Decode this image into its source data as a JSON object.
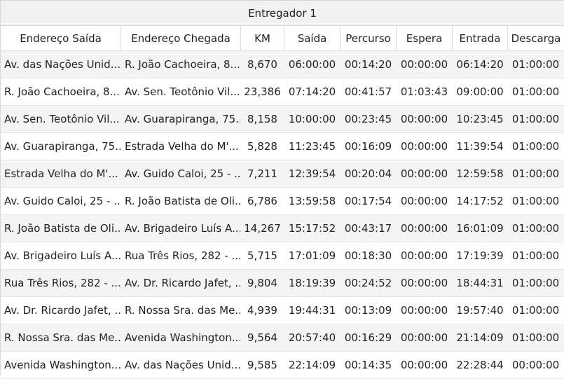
{
  "table": {
    "title": "Entregador 1",
    "columns": [
      "Endereço Saída",
      "Endereço Chegada",
      "KM",
      "Saída",
      "Percurso",
      "Espera",
      "Entrada",
      "Descarga"
    ],
    "rows": [
      [
        "Av. das Nações Unid...",
        "R. João Cachoeira, 8...",
        "8,670",
        "06:00:00",
        "00:14:20",
        "00:00:00",
        "06:14:20",
        "01:00:00"
      ],
      [
        "R. João Cachoeira, 8...",
        "Av. Sen. Teotônio Vil...",
        "23,386",
        "07:14:20",
        "00:41:57",
        "01:03:43",
        "09:00:00",
        "01:00:00"
      ],
      [
        "Av. Sen. Teotônio Vil...",
        "Av. Guarapiranga, 75...",
        "8,158",
        "10:00:00",
        "00:23:45",
        "00:00:00",
        "10:23:45",
        "01:00:00"
      ],
      [
        "Av. Guarapiranga, 75...",
        "Estrada Velha do M'...",
        "5,828",
        "11:23:45",
        "00:16:09",
        "00:00:00",
        "11:39:54",
        "01:00:00"
      ],
      [
        "Estrada Velha do M'...",
        "Av. Guido Caloi, 25 - ...",
        "7,211",
        "12:39:54",
        "00:20:04",
        "00:00:00",
        "12:59:58",
        "01:00:00"
      ],
      [
        "Av. Guido Caloi, 25 - ...",
        "R. João Batista de Oli...",
        "6,786",
        "13:59:58",
        "00:17:54",
        "00:00:00",
        "14:17:52",
        "01:00:00"
      ],
      [
        "R. João Batista de Oli...",
        "Av. Brigadeiro Luís A...",
        "14,267",
        "15:17:52",
        "00:43:17",
        "00:00:00",
        "16:01:09",
        "01:00:00"
      ],
      [
        "Av. Brigadeiro Luís A...",
        "Rua Três Rios, 282 - ...",
        "5,715",
        "17:01:09",
        "00:18:30",
        "00:00:00",
        "17:19:39",
        "01:00:00"
      ],
      [
        "Rua Três Rios, 282 - ...",
        "Av. Dr. Ricardo Jafet, ...",
        "9,804",
        "18:19:39",
        "00:24:52",
        "00:00:00",
        "18:44:31",
        "01:00:00"
      ],
      [
        "Av. Dr. Ricardo Jafet, ...",
        "R. Nossa Sra. das Me...",
        "4,939",
        "19:44:31",
        "00:13:09",
        "00:00:00",
        "19:57:40",
        "01:00:00"
      ],
      [
        "R. Nossa Sra. das Me...",
        "Avenida Washington...",
        "9,564",
        "20:57:40",
        "00:16:29",
        "00:00:00",
        "21:14:09",
        "01:00:00"
      ],
      [
        "Avenida Washington...",
        "Av. das Nações Unid...",
        "9,585",
        "22:14:09",
        "00:14:35",
        "00:00:00",
        "22:28:44",
        "00:00:00"
      ]
    ]
  }
}
